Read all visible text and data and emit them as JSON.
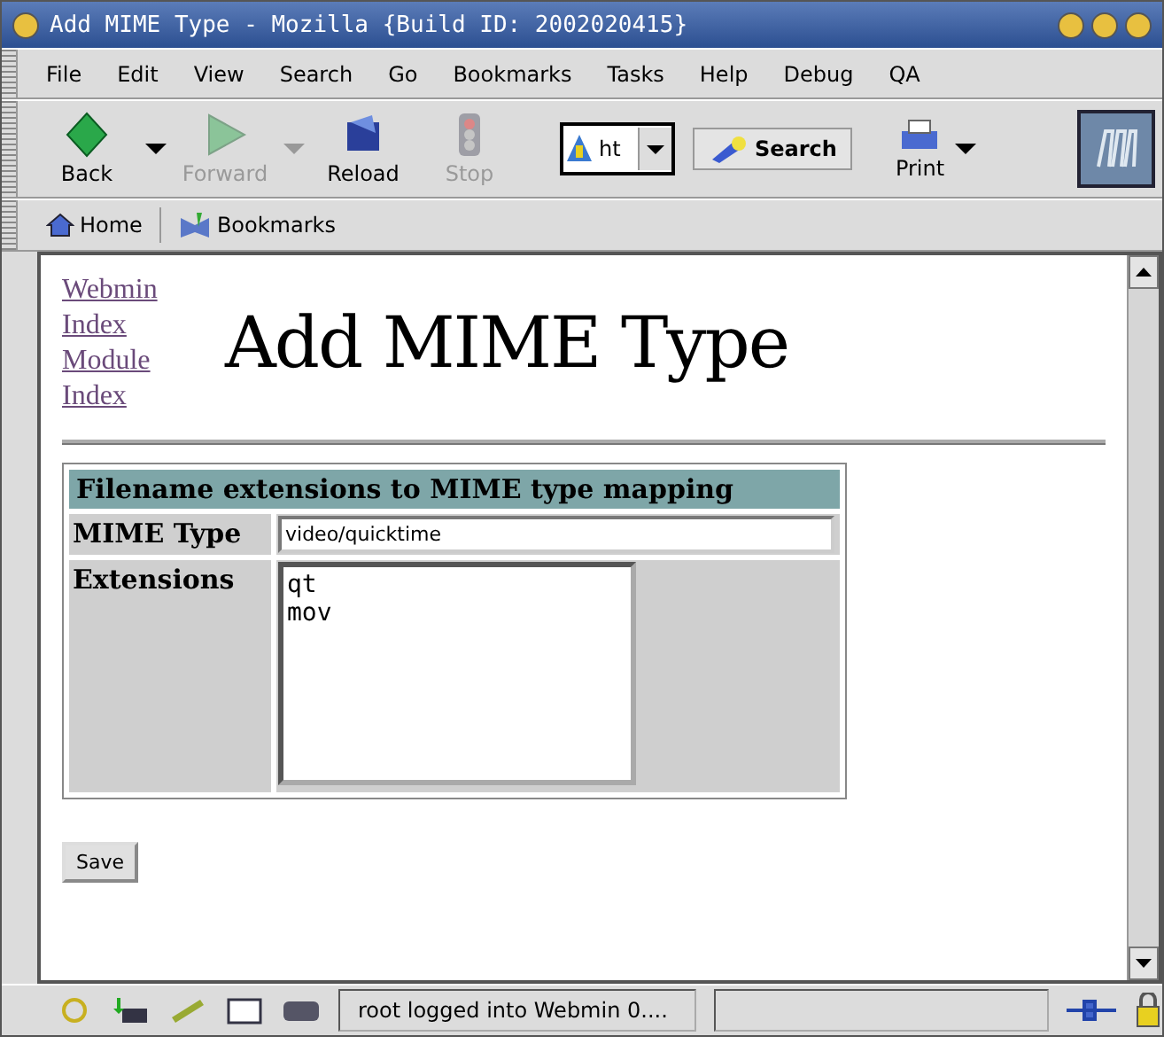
{
  "window": {
    "title": "Add MIME Type - Mozilla {Build ID: 2002020415}"
  },
  "menu": [
    "File",
    "Edit",
    "View",
    "Search",
    "Go",
    "Bookmarks",
    "Tasks",
    "Help",
    "Debug",
    "QA"
  ],
  "toolbar": [
    {
      "label": "Back",
      "kind": "back",
      "disabled": false,
      "dropdown": true
    },
    {
      "label": "Forward",
      "kind": "forward",
      "disabled": true,
      "dropdown": true
    },
    {
      "label": "Reload",
      "kind": "reload",
      "disabled": false,
      "dropdown": false
    },
    {
      "label": "Stop",
      "kind": "stop",
      "disabled": true,
      "dropdown": false
    }
  ],
  "url_field": {
    "value": "ht"
  },
  "search_button": "Search",
  "print_button": "Print",
  "personal_bar": [
    {
      "label": "Home",
      "kind": "home"
    },
    {
      "label": "Bookmarks",
      "kind": "bookmarks"
    }
  ],
  "nav_links": [
    "Webmin Index",
    "Module Index"
  ],
  "page_title": "Add MIME Type",
  "form": {
    "header": "Filename extensions to MIME type mapping",
    "mime_label": "MIME Type",
    "mime_value": "video/quicktime",
    "ext_label": "Extensions",
    "ext_value": "qt\nmov"
  },
  "save_button": "Save",
  "status_text": "root logged into Webmin 0...."
}
